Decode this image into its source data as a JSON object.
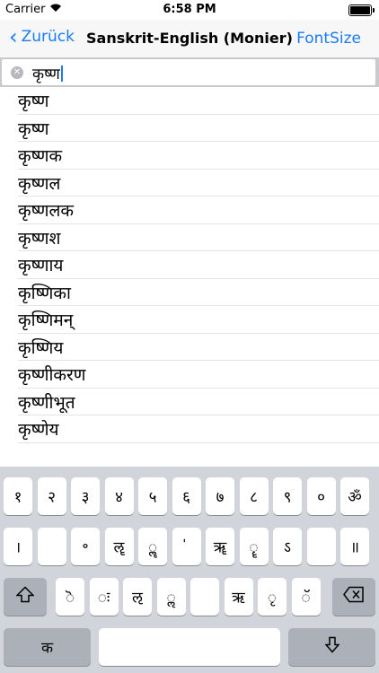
{
  "status": {
    "carrier": "Carrier",
    "time": "6:58 PM",
    "battery_level": 1.0
  },
  "nav": {
    "back_label": "Zurück",
    "title": "Sanskrit-English (Monier)",
    "right_label": "FontSize"
  },
  "search": {
    "value": "कृष्ण"
  },
  "results": [
    "कृष्ण",
    "कृष्ण",
    "कृष्णक",
    "कृष्णल",
    "कृष्णलक",
    "कृष्णश",
    "कृष्णाय",
    "कृष्णिका",
    "कृष्णिमन्",
    "कृष्णिय",
    "कृष्णीकरण",
    "कृष्णीभूत",
    "कृष्णेय"
  ],
  "keyboard": {
    "row1": [
      "१",
      "२",
      "३",
      "४",
      "५",
      "६",
      "७",
      "८",
      "९",
      "०",
      "ॐ"
    ],
    "row2": [
      "।",
      "",
      "॰",
      "ॡ",
      "ॣ",
      "॑",
      "ॠ",
      "ॄ",
      "ऽ",
      "",
      "॥"
    ],
    "row3": [
      "ॆ",
      "ः",
      "ऌ",
      "ॢ",
      "",
      "ऋ",
      "ृ",
      "ॅ"
    ],
    "bottom_left": "क"
  }
}
